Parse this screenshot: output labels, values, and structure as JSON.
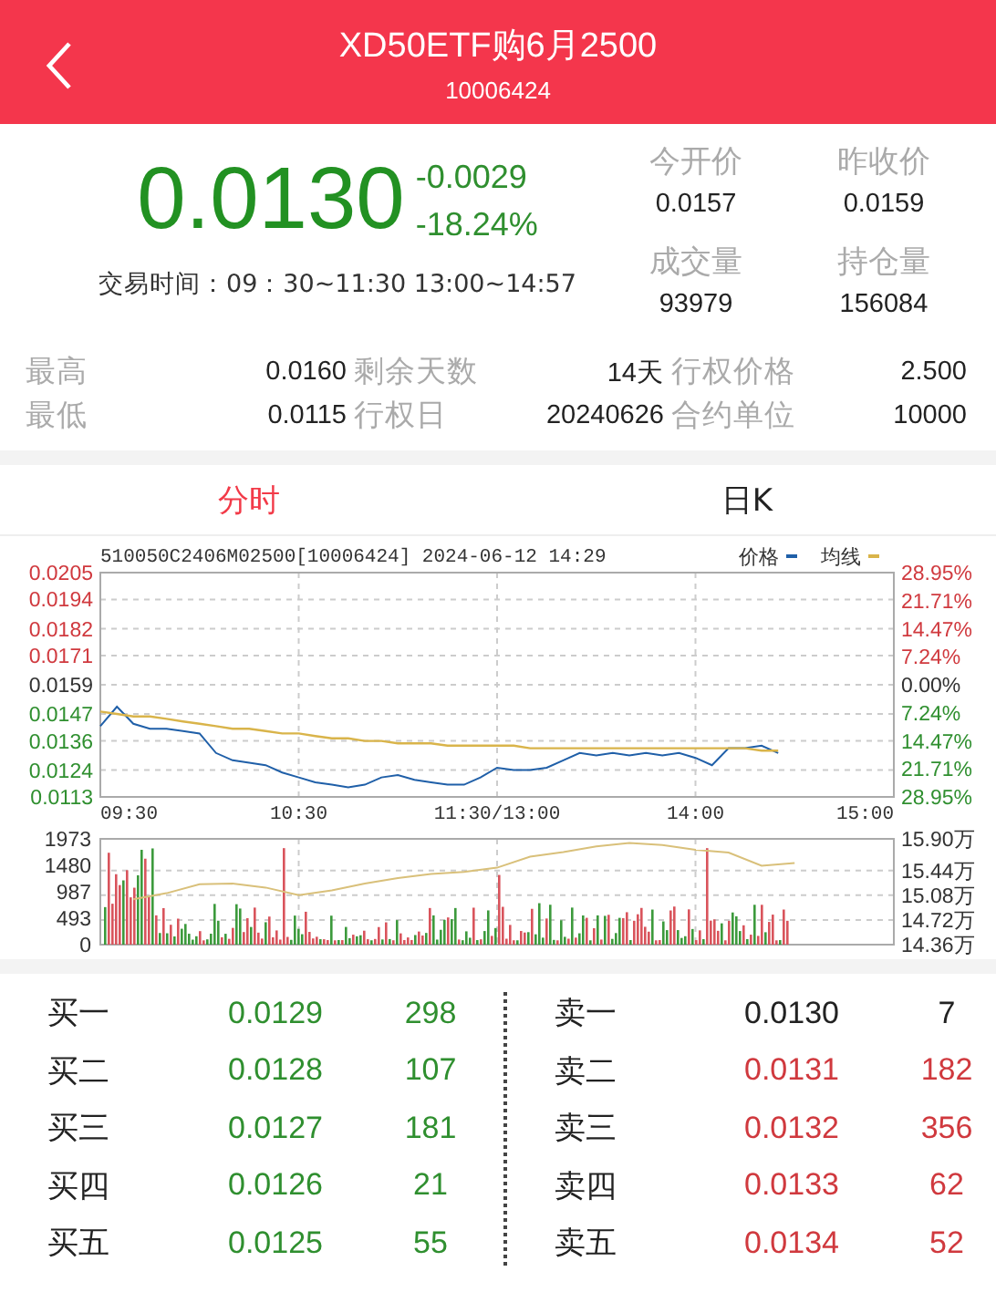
{
  "header": {
    "title": "XD50ETF购6月2500",
    "code": "10006424"
  },
  "quote": {
    "price": "0.0130",
    "change": "-0.0029",
    "change_pct": "-18.24%",
    "trading_hours": "交易时间：09：30~11:30 13:00~14:57"
  },
  "summary": [
    {
      "label": "今开价",
      "value": "0.0157"
    },
    {
      "label": "昨收价",
      "value": "0.0159"
    },
    {
      "label": "成交量",
      "value": "93979"
    },
    {
      "label": "持仓量",
      "value": "156084"
    }
  ],
  "stats": [
    {
      "label": "最高",
      "value": "0.0160"
    },
    {
      "label": "剩余天数",
      "value": "14天"
    },
    {
      "label": "行权价格",
      "value": "2.500"
    },
    {
      "label": "最低",
      "value": "0.0115"
    },
    {
      "label": "行权日",
      "value": "20240626"
    },
    {
      "label": "合约单位",
      "value": "10000"
    }
  ],
  "tabs": [
    {
      "label": "分时",
      "selected": true
    },
    {
      "label": "日K",
      "selected": false
    }
  ],
  "chart": {
    "chart_data": {
      "type": "line",
      "title": "510050C2406M02500[10006424] 2024-06-12 14:29",
      "categories": [
        null,
        null,
        null,
        null,
        null,
        null,
        null,
        null,
        null,
        null,
        null,
        null,
        null,
        null,
        null,
        null,
        null,
        null,
        null,
        null,
        null,
        null,
        null,
        null,
        null,
        null,
        null,
        null,
        null,
        null,
        null,
        null,
        null,
        null,
        null,
        null,
        null,
        null,
        null,
        null,
        null,
        null
      ],
      "series": [
        {
          "name": "价格",
          "color": "#1f5fa8",
          "values": [
            0.0142,
            0.015,
            0.0143,
            0.0141,
            0.0141,
            0.014,
            0.0139,
            0.0131,
            0.0128,
            0.0127,
            0.0126,
            0.0123,
            0.0121,
            0.0119,
            0.0118,
            0.0117,
            0.0118,
            0.0121,
            0.0122,
            0.012,
            0.0119,
            0.0118,
            0.0118,
            0.0121,
            0.0125,
            0.0124,
            0.0124,
            0.0125,
            0.0128,
            0.0131,
            0.013,
            0.0131,
            0.013,
            0.0131,
            0.013,
            0.0131,
            0.0129,
            0.0126,
            0.0133,
            0.0133,
            0.0134,
            0.0131
          ]
        },
        {
          "name": "均线",
          "color": "#d9b44a",
          "values": [
            0.0148,
            0.0147,
            0.0146,
            0.0146,
            0.0145,
            0.0144,
            0.0143,
            0.0142,
            0.0141,
            0.0141,
            0.014,
            0.0139,
            0.0139,
            0.0138,
            0.0137,
            0.0137,
            0.0136,
            0.0136,
            0.0135,
            0.0135,
            0.0135,
            0.0134,
            0.0134,
            0.0134,
            0.0134,
            0.0134,
            0.0133,
            0.0133,
            0.0133,
            0.0133,
            0.0133,
            0.0133,
            0.0133,
            0.0133,
            0.0133,
            0.0133,
            0.0133,
            0.0133,
            0.0133,
            0.0133,
            0.0132,
            0.0132
          ]
        }
      ],
      "ylim": [
        0.0113,
        0.0205
      ],
      "yticks": [
        {
          "value": 0.0205,
          "label": "0.0205"
        },
        {
          "value": 0.0194,
          "label": "0.0194"
        },
        {
          "value": 0.0182,
          "label": "0.0182"
        },
        {
          "value": 0.0171,
          "label": "0.0171"
        },
        {
          "value": 0.0159,
          "label": "0.0159"
        },
        {
          "value": 0.0147,
          "label": "0.0147"
        },
        {
          "value": 0.0136,
          "label": "0.0136"
        },
        {
          "value": 0.0124,
          "label": "0.0124"
        },
        {
          "value": 0.0113,
          "label": "0.0113"
        }
      ],
      "grid": true,
      "legend": "top-right"
    },
    "pct_ticks": [
      {
        "label": "28.95%",
        "color": "#d0393e"
      },
      {
        "label": "21.71%",
        "color": "#d0393e"
      },
      {
        "label": "14.47%",
        "color": "#d0393e"
      },
      {
        "label": "7.24%",
        "color": "#d0393e"
      },
      {
        "label": "0.00%",
        "color": "#333333"
      },
      {
        "label": "7.24%",
        "color": "#2f8f2f"
      },
      {
        "label": "14.47%",
        "color": "#2f8f2f"
      },
      {
        "label": "21.71%",
        "color": "#2f8f2f"
      },
      {
        "label": "28.95%",
        "color": "#2f8f2f"
      }
    ],
    "time_ticks": [
      "09:30",
      "10:30",
      "11:30/13:00",
      "14:00",
      "15:00"
    ]
  },
  "volume_panel": {
    "volume_ticks": [
      "1973",
      "1480",
      "987",
      "493",
      "0"
    ],
    "chart_data": {
      "type": "line",
      "categories": [
        null,
        null,
        null,
        null,
        null,
        null,
        null,
        null,
        null,
        null,
        null,
        null,
        null,
        null,
        null,
        null,
        null,
        null,
        null,
        null,
        null
      ],
      "series": [
        {
          "color": "#d9c07a",
          "values": [
            15.02,
            15.11,
            15.24,
            15.25,
            15.19,
            15.08,
            15.15,
            15.25,
            15.33,
            15.39,
            15.42,
            15.48,
            15.64,
            15.71,
            15.79,
            15.84,
            15.81,
            15.74,
            15.7,
            15.51,
            15.55
          ]
        }
      ],
      "ylim": [
        14.36,
        15.9
      ],
      "yticks": [
        {
          "value": 15.9,
          "label": "15.90万"
        },
        {
          "value": 15.44,
          "label": "15.44万"
        },
        {
          "value": 15.08,
          "label": "15.08万"
        },
        {
          "value": 14.72,
          "label": "14.72万"
        },
        {
          "value": 14.36,
          "label": "14.36万"
        }
      ],
      "grid": true
    }
  },
  "order_book": {
    "bids": [
      {
        "label": "买一",
        "price": "0.0129",
        "volume": "298",
        "color": "#2f8f2f"
      },
      {
        "label": "买二",
        "price": "0.0128",
        "volume": "107",
        "color": "#2f8f2f"
      },
      {
        "label": "买三",
        "price": "0.0127",
        "volume": "181",
        "color": "#2f8f2f"
      },
      {
        "label": "买四",
        "price": "0.0126",
        "volume": "21",
        "color": "#2f8f2f"
      },
      {
        "label": "买五",
        "price": "0.0125",
        "volume": "55",
        "color": "#2f8f2f"
      }
    ],
    "asks": [
      {
        "label": "卖一",
        "price": "0.0130",
        "volume": "7",
        "color": "#222222"
      },
      {
        "label": "卖二",
        "price": "0.0131",
        "volume": "182",
        "color": "#d0393e"
      },
      {
        "label": "卖三",
        "price": "0.0132",
        "volume": "356",
        "color": "#d0393e"
      },
      {
        "label": "卖四",
        "price": "0.0133",
        "volume": "62",
        "color": "#d0393e"
      },
      {
        "label": "卖五",
        "price": "0.0134",
        "volume": "52",
        "color": "#d0393e"
      }
    ]
  }
}
